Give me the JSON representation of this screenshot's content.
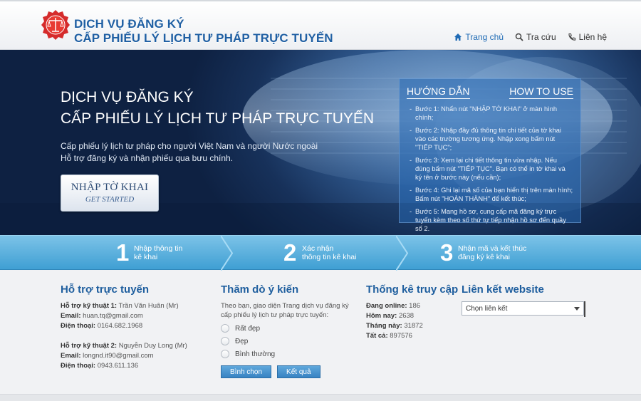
{
  "header": {
    "title_line1": "DỊCH VỤ ĐĂNG KÝ",
    "title_line2": "CẤP PHIẾU LÝ LỊCH TƯ PHÁP TRỰC TUYẾN",
    "nav": [
      {
        "label": "Trang chủ",
        "icon": "home-icon"
      },
      {
        "label": "Tra cứu",
        "icon": "search-icon"
      },
      {
        "label": "Liên hệ",
        "icon": "phone-icon"
      }
    ]
  },
  "hero": {
    "title_line1": "DỊCH VỤ ĐĂNG KÝ",
    "title_line2": "CẤP PHIẾU LÝ LỊCH TƯ PHÁP TRỰC TUYẾN",
    "desc_line1": "Cấp phiếu lý lịch tư pháp cho người Việt Nam và người Nước ngoài",
    "desc_line2": "Hỗ trợ đăng ký và nhận phiếu qua bưu chính.",
    "cta_main": "NHẬP TỜ KHAI",
    "cta_sub": "GET STARTED"
  },
  "guide": {
    "title_vi": "HƯỚNG DẪN",
    "title_en": "HOW TO USE",
    "steps": [
      "Bước 1: Nhấn nút \"NHẬP TỜ KHAI\" ở màn hình chính;",
      "Bước 2: Nhập đầy đủ thông tin chi tiết của tờ khai vào các trường tương ứng. Nhập xong bấm nút \"TIẾP TỤC\";",
      "Bước 3: Xem lại chi tiết thông tin vừa nhập. Nếu đúng bấm nút \"TIẾP TỤC\". Bạn có thể in tờ khai và ký tên ở bước này (nếu cần);",
      "Bước 4: Ghi lại mã số của bạn hiển thị trên màn hình; Bấm nút \"HOÀN THÀNH\" để kết thúc;",
      "Bước 5: Mang hồ sơ, cung cấp mã đăng ký trực tuyến kèm theo số thứ tự tiếp nhận hồ sơ đến quầy số 2."
    ]
  },
  "process": [
    {
      "num": "1",
      "line1": "Nhập thông tin",
      "line2": "kê khai"
    },
    {
      "num": "2",
      "line1": "Xác nhận",
      "line2": "thông tin kê khai"
    },
    {
      "num": "3",
      "line1": "Nhận mã và kết thúc",
      "line2": "đăng ký kê khai"
    }
  ],
  "support": {
    "title": "Hỗ trợ trực tuyến",
    "tech1_label": "Hỗ trợ kỹ thuật 1:",
    "tech1_name": "Trần Văn Huân (Mr)",
    "tech1_email_label": "Email:",
    "tech1_email": "huan.tq@gmail.com",
    "tech1_phone_label": "Điện thoại:",
    "tech1_phone": "0164.682.1968",
    "tech2_label": "Hỗ trợ kỹ thuật 2:",
    "tech2_name": "Nguyễn Duy Long (Mr)",
    "tech2_email_label": "Email:",
    "tech2_email": "longnd.it90@gmail.com",
    "tech2_phone_label": "Điện thoại:",
    "tech2_phone": "0943.611.136"
  },
  "poll": {
    "title": "Thăm dò ý kiến",
    "question": "Theo bạn, giao diện Trang dịch vụ đăng ký cấp phiếu lý lịch tư pháp trực tuyến:",
    "options": [
      "Rất đẹp",
      "Đẹp",
      "Bình thường"
    ],
    "vote_label": "Bình chọn",
    "result_label": "Kết quả"
  },
  "stats": {
    "title": "Thống kê truy cập",
    "online_label": "Đang online:",
    "online": "186",
    "today_label": "Hôm nay:",
    "today": "2638",
    "month_label": "Tháng này:",
    "month": "31872",
    "total_label": "Tất cả:",
    "total": "897576"
  },
  "links": {
    "title": "Liên kết website",
    "select_value": "Chọn liên kết"
  },
  "colors": {
    "brand_blue": "#1f5fa3",
    "step_bar": "#4aa6d8",
    "button_blue": "#3782c2"
  }
}
